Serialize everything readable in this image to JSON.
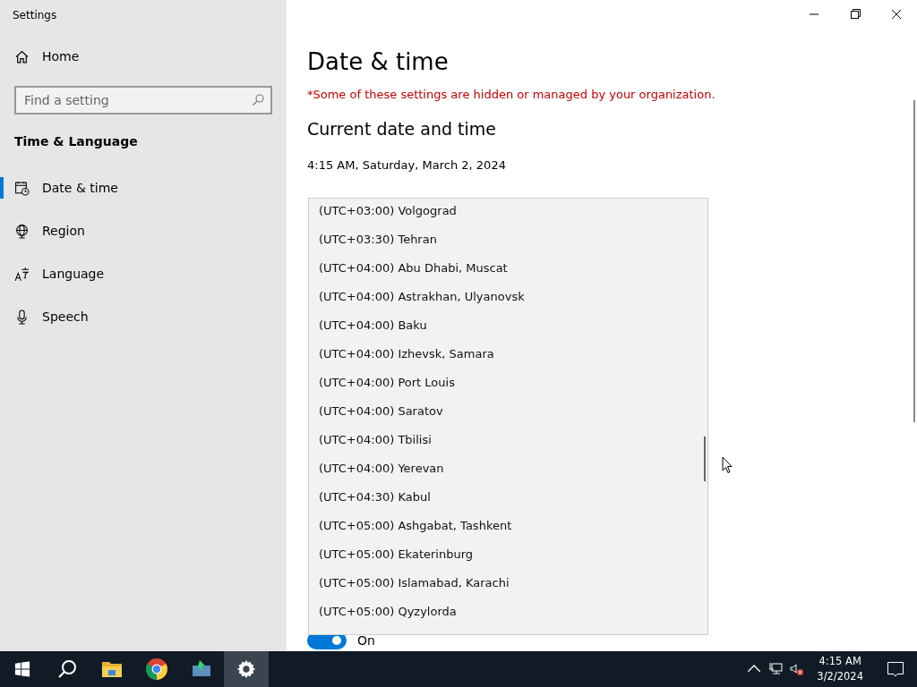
{
  "window": {
    "title": "Settings"
  },
  "sidebar": {
    "home": "Home",
    "search": {
      "placeholder": "Find a setting"
    },
    "section": "Time & Language",
    "items": [
      {
        "label": "Date & time",
        "kind": "calendar",
        "selected": true
      },
      {
        "label": "Region",
        "kind": "globe",
        "selected": false
      },
      {
        "label": "Language",
        "kind": "language",
        "selected": false
      },
      {
        "label": "Speech",
        "kind": "mic",
        "selected": false
      }
    ]
  },
  "main": {
    "title": "Date & time",
    "notice": "*Some of these settings are hidden or managed by your organization.",
    "section": "Current date and time",
    "current": "4:15 AM, Saturday, March 2, 2024",
    "toggle": {
      "label": "On",
      "on": true
    },
    "timezone_list": [
      "(UTC+03:00) Volgograd",
      "(UTC+03:30) Tehran",
      "(UTC+04:00) Abu Dhabi, Muscat",
      "(UTC+04:00) Astrakhan, Ulyanovsk",
      "(UTC+04:00) Baku",
      "(UTC+04:00) Izhevsk, Samara",
      "(UTC+04:00) Port Louis",
      "(UTC+04:00) Saratov",
      "(UTC+04:00) Tbilisi",
      "(UTC+04:00) Yerevan",
      "(UTC+04:30) Kabul",
      "(UTC+05:00) Ashgabat, Tashkent",
      "(UTC+05:00) Ekaterinburg",
      "(UTC+05:00) Islamabad, Karachi",
      "(UTC+05:00) Qyzylorda"
    ]
  },
  "taskbar": {
    "apps": [
      {
        "kind": "start",
        "selected": false
      },
      {
        "kind": "search",
        "selected": false
      },
      {
        "kind": "folder",
        "selected": false
      },
      {
        "kind": "browser",
        "selected": false
      },
      {
        "kind": "app",
        "selected": false
      },
      {
        "kind": "settings",
        "selected": true
      }
    ],
    "time": "4:15 AM",
    "date": "3/2/2024"
  }
}
